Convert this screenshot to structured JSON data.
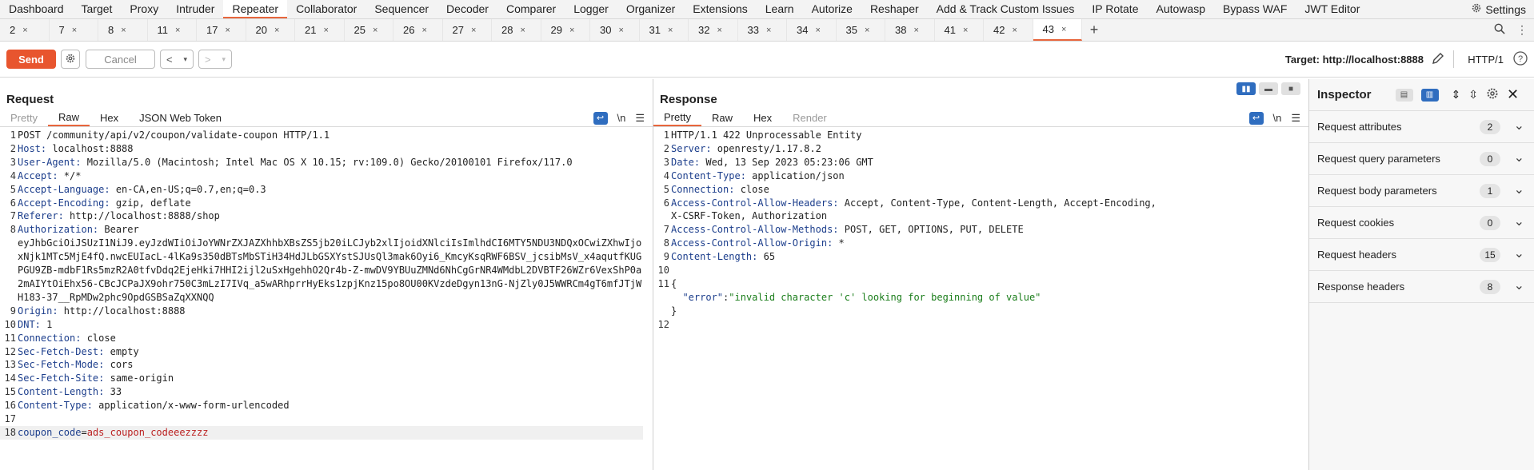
{
  "topnav": {
    "items": [
      "Dashboard",
      "Target",
      "Proxy",
      "Intruder",
      "Repeater",
      "Collaborator",
      "Sequencer",
      "Decoder",
      "Comparer",
      "Logger",
      "Organizer",
      "Extensions",
      "Learn",
      "Autorize",
      "Reshaper",
      "Add & Track Custom Issues",
      "IP Rotate",
      "Autowasp",
      "Bypass WAF",
      "JWT Editor"
    ],
    "active": "Repeater",
    "settings_label": "Settings"
  },
  "repeater_tabs": {
    "labels": [
      "2",
      "7",
      "8",
      "11",
      "17",
      "20",
      "21",
      "25",
      "26",
      "27",
      "28",
      "29",
      "30",
      "31",
      "32",
      "33",
      "34",
      "35",
      "38",
      "41",
      "42",
      "43"
    ],
    "active": "43",
    "close_glyph": "×",
    "add_glyph": "+"
  },
  "toolbar": {
    "send_label": "Send",
    "cancel_label": "Cancel",
    "target_label": "Target: http://localhost:8888",
    "protocol_label": "HTTP/1"
  },
  "request": {
    "title": "Request",
    "tabs": [
      "Pretty",
      "Raw",
      "Hex",
      "JSON Web Token"
    ],
    "active_tab": "Raw",
    "newline_label": "\\n",
    "lines": [
      {
        "n": "1",
        "key": "",
        "val": "POST /community/api/v2/coupon/validate-coupon HTTP/1.1"
      },
      {
        "n": "2",
        "key": "Host:",
        "val": " localhost:8888"
      },
      {
        "n": "3",
        "key": "User-Agent:",
        "val": " Mozilla/5.0 (Macintosh; Intel Mac OS X 10.15; rv:109.0) Gecko/20100101 Firefox/117.0"
      },
      {
        "n": "4",
        "key": "Accept:",
        "val": " */*"
      },
      {
        "n": "5",
        "key": "Accept-Language:",
        "val": " en-CA,en-US;q=0.7,en;q=0.3"
      },
      {
        "n": "6",
        "key": "Accept-Encoding:",
        "val": " gzip, deflate"
      },
      {
        "n": "7",
        "key": "Referer:",
        "val": " http://localhost:8888/shop"
      },
      {
        "n": "8",
        "key": "Authorization:",
        "val": " Bearer\neyJhbGciOiJSUzI1NiJ9.eyJzdWIiOiJoYWNrZXJAZXhhbXBsZS5jb20iLCJyb2xlIjoidXNlciIsImlhdCI6MTY5NDU3NDQxOCwiZXhwIjoxNjk1MTc5MjE4fQ.nwcEUIacL-4lKa9s350dBTsMbSTiH34HdJLbGSXYstSJUsQl3mak6Oyi6_KmcyKsqRWF6BSV_jcsibMsV_x4aqutfKUGPGU9ZB-mdbF1Rs5mzR2A0tfvDdq2EjeHki7HHI2ijl2uSxHgehhO2Qr4b-Z-mwDV9YBUuZMNd6NhCgGrNR4WMdbL2DVBTF26WZr6VexShP0a2mAIYtOiEhx56-CBcJCPaJX9ohr750C3mLzI7IVq_a5wARhprrHyEks1zpjKnz15po8OU00KVzdeDgyn13nG-NjZly0J5WWRCm4gT6mfJTjWH183-37__RpMDw2phc9OpdGSBSaZqXXNQQ"
      },
      {
        "n": "9",
        "key": "Origin:",
        "val": " http://localhost:8888"
      },
      {
        "n": "10",
        "key": "DNT:",
        "val": " 1"
      },
      {
        "n": "11",
        "key": "Connection:",
        "val": " close"
      },
      {
        "n": "12",
        "key": "Sec-Fetch-Dest:",
        "val": " empty"
      },
      {
        "n": "13",
        "key": "Sec-Fetch-Mode:",
        "val": " cors"
      },
      {
        "n": "14",
        "key": "Sec-Fetch-Site:",
        "val": " same-origin"
      },
      {
        "n": "15",
        "key": "Content-Length:",
        "val": " 33"
      },
      {
        "n": "16",
        "key": "Content-Type:",
        "val": " application/x-www-form-urlencoded"
      },
      {
        "n": "17",
        "key": "",
        "val": ""
      },
      {
        "n": "18",
        "key": "coupon_code",
        "val": "=",
        "val2": "ads_coupon_codeeezzzz"
      }
    ]
  },
  "response": {
    "title": "Response",
    "tabs": [
      "Pretty",
      "Raw",
      "Hex",
      "Render"
    ],
    "active_tab": "Pretty",
    "newline_label": "\\n",
    "lines": [
      {
        "n": "1",
        "key": "",
        "val": "HTTP/1.1 422 Unprocessable Entity"
      },
      {
        "n": "2",
        "key": "Server:",
        "val": " openresty/1.17.8.2"
      },
      {
        "n": "3",
        "key": "Date:",
        "val": " Wed, 13 Sep 2023 05:23:06 GMT"
      },
      {
        "n": "4",
        "key": "Content-Type:",
        "val": " application/json"
      },
      {
        "n": "5",
        "key": "Connection:",
        "val": " close"
      },
      {
        "n": "6",
        "key": "Access-Control-Allow-Headers:",
        "val": " Accept, Content-Type, Content-Length, Accept-Encoding,\nX-CSRF-Token, Authorization"
      },
      {
        "n": "7",
        "key": "Access-Control-Allow-Methods:",
        "val": " POST, GET, OPTIONS, PUT, DELETE"
      },
      {
        "n": "8",
        "key": "Access-Control-Allow-Origin:",
        "val": " *"
      },
      {
        "n": "9",
        "key": "Content-Length:",
        "val": " 65"
      },
      {
        "n": "10",
        "key": "",
        "val": ""
      },
      {
        "n": "11",
        "key": "",
        "val": "{"
      },
      {
        "n": "",
        "key": "",
        "val": "  ",
        "jk": "\"error\"",
        "jsep": ":",
        "jv": "\"invalid character 'c' looking for beginning of value\""
      },
      {
        "n": "",
        "key": "",
        "val": "}"
      },
      {
        "n": "12",
        "key": "",
        "val": ""
      }
    ]
  },
  "inspector": {
    "title": "Inspector",
    "rows": [
      {
        "label": "Request attributes",
        "count": "2"
      },
      {
        "label": "Request query parameters",
        "count": "0"
      },
      {
        "label": "Request body parameters",
        "count": "1"
      },
      {
        "label": "Request cookies",
        "count": "0"
      },
      {
        "label": "Request headers",
        "count": "15"
      },
      {
        "label": "Response headers",
        "count": "8"
      }
    ]
  },
  "colors": {
    "accent": "#e8663c",
    "send": "#e8552e",
    "blue": "#2f6dbf",
    "header_key": "#1c3e8c",
    "param_value": "#bb2222",
    "json_value": "#1a7d1a"
  }
}
